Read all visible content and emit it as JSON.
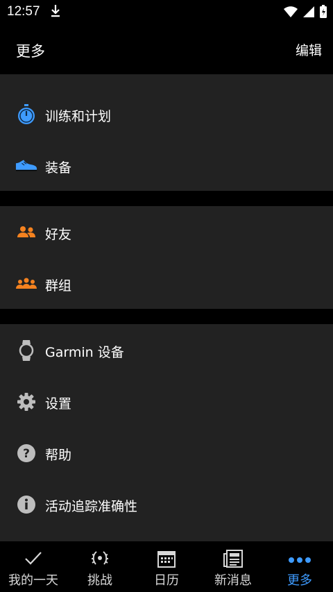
{
  "status_bar": {
    "time": "12:57"
  },
  "header": {
    "title": "更多",
    "edit_label": "编辑"
  },
  "sections": [
    {
      "items": [
        {
          "label": "训练和计划",
          "icon": "stopwatch-icon"
        },
        {
          "label": "装备",
          "icon": "shoe-icon"
        }
      ]
    },
    {
      "items": [
        {
          "label": "好友",
          "icon": "friends-icon"
        },
        {
          "label": "群组",
          "icon": "group-icon"
        }
      ]
    },
    {
      "items": [
        {
          "label": "Garmin 设备",
          "icon": "watch-icon"
        },
        {
          "label": "设置",
          "icon": "gear-icon"
        },
        {
          "label": "帮助",
          "icon": "help-icon"
        },
        {
          "label": "活动追踪准确性",
          "icon": "info-icon"
        }
      ]
    }
  ],
  "bottom_nav": [
    {
      "label": "我的一天",
      "icon": "check-icon"
    },
    {
      "label": "挑战",
      "icon": "laurel-icon"
    },
    {
      "label": "日历",
      "icon": "calendar-icon"
    },
    {
      "label": "新消息",
      "icon": "news-icon"
    },
    {
      "label": "更多",
      "icon": "more-dots-icon",
      "active": true
    }
  ],
  "colors": {
    "accent": "#3e9bff",
    "orange": "#f5821f",
    "section_bg": "#222222"
  }
}
